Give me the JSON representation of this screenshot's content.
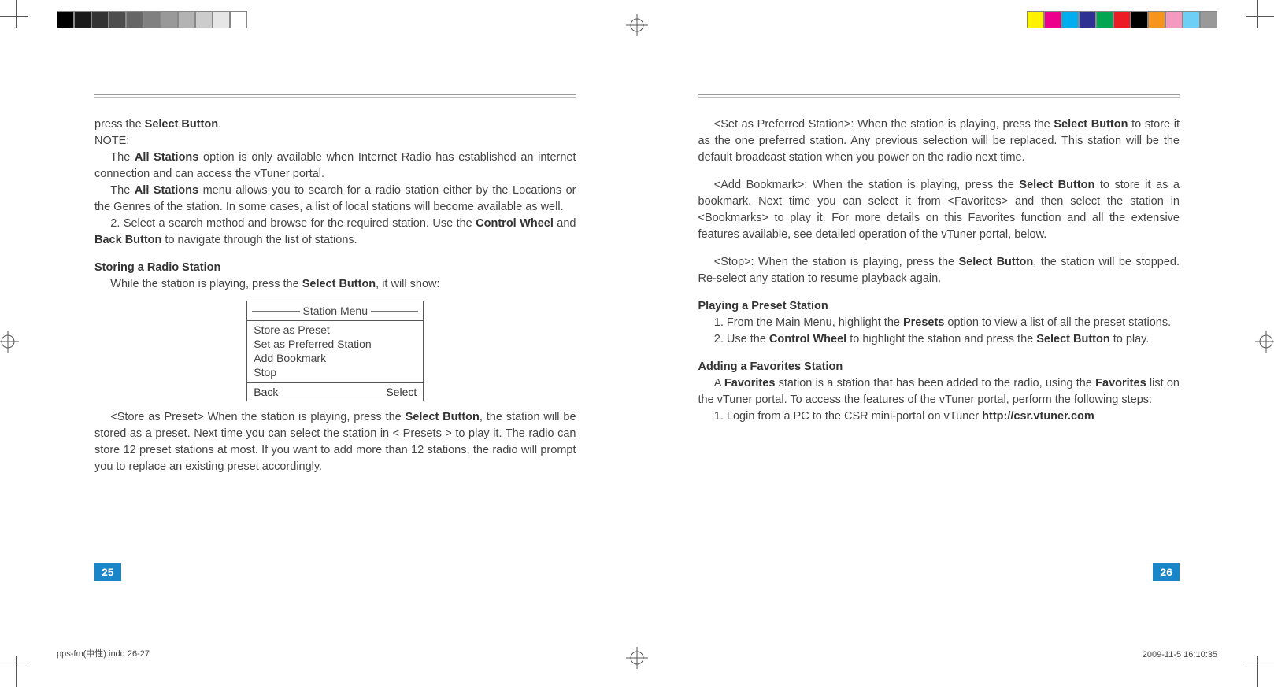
{
  "print": {
    "gray_swatches": [
      "#000000",
      "#1a1a1a",
      "#333333",
      "#4d4d4d",
      "#666666",
      "#808080",
      "#999999",
      "#b3b3b3",
      "#cccccc",
      "#e6e6e6",
      "#ffffff"
    ],
    "color_swatches": [
      "#fff200",
      "#ec008c",
      "#00aeef",
      "#2e3192",
      "#00a651",
      "#ed1c24",
      "#000000",
      "#f7941d",
      "#f49ac1",
      "#6dcff6",
      "#999999"
    ]
  },
  "left": {
    "p1_a": "press the ",
    "p1_b": "Select Button",
    "p1_c": ".",
    "note": "NOTE:",
    "p2_a": "The ",
    "p2_b": "All Stations",
    "p2_c": " option is only available when Internet Radio has established an internet connection and can access the vTuner portal.",
    "p3_a": "The ",
    "p3_b": "All Stations",
    "p3_c": " menu allows you to search for a radio station either by the Locations or the Genres of the station. In some cases, a list of local stations will become available as well.",
    "p4_a": "2. Select a search method and browse for the required station. Use the ",
    "p4_b": "Control Wheel",
    "p4_c": " and ",
    "p4_d": "Back Button",
    "p4_e": " to navigate through the list of stations.",
    "h1": "Storing a Radio Station",
    "p5_a": "While the station is playing, press the ",
    "p5_b": "Select Button",
    "p5_c": ", it will show:",
    "menu": {
      "title": "Station Menu",
      "items": [
        "Store as Preset",
        "Set as Preferred Station",
        "Add Bookmark",
        "Stop"
      ],
      "back": "Back",
      "select": "Select"
    },
    "p6_a": "<Store as Preset> When the station is playing, press the ",
    "p6_b": "Select Button",
    "p6_c": ", the station will be stored as a preset. Next time you can select the station in < Presets > to play it. The radio can store 12 preset stations at most. If you want to add more than 12 stations, the radio will prompt you to replace an existing preset accordingly.",
    "page_num": "25"
  },
  "right": {
    "p1_a": "<Set as Preferred Station>: When the station is playing, press the ",
    "p1_b": "Select Button",
    "p1_c": " to store it as the one preferred station. Any previous selection will be replaced. This station will be the default broadcast station when you power on the radio next time.",
    "p2_a": "<Add Bookmark>: When the station is playing, press the ",
    "p2_b": "Select Button",
    "p2_c": " to store it as a bookmark. Next time you can select it from <Favorites> and then select the station in <Bookmarks> to play it. For more details on this Favorites function and all the extensive features available, see detailed operation of the vTuner portal, below.",
    "p3_a": "<Stop>: When the station is playing, press the ",
    "p3_b": "Select Button",
    "p3_c": ", the station will be stopped. Re-select any station to resume playback again.",
    "h1": "Playing a Preset Station",
    "p4_a": "1. From the Main Menu, highlight the ",
    "p4_b": "Presets",
    "p4_c": " option to view a list of all the preset stations.",
    "p5_a": "2. Use the ",
    "p5_b": "Control Wheel",
    "p5_c": " to highlight the station and press the ",
    "p5_d": "Select Button",
    "p5_e": " to play.",
    "h2": "Adding a Favorites Station",
    "p6_a": "A ",
    "p6_b": "Favorites",
    "p6_c": " station is a station that has been added to the radio, using the ",
    "p6_d": "Favorites",
    "p6_e": " list on the vTuner portal. To access the features of the vTuner portal, perform the following steps:",
    "p7_a": "1. Login from a PC to the CSR mini-portal on vTuner ",
    "p7_b": "http://csr.vtuner.com",
    "page_num": "26"
  },
  "footer": {
    "file": "pps-fm(中性).indd   26-27",
    "timestamp": "2009-11-5   16:10:35"
  }
}
